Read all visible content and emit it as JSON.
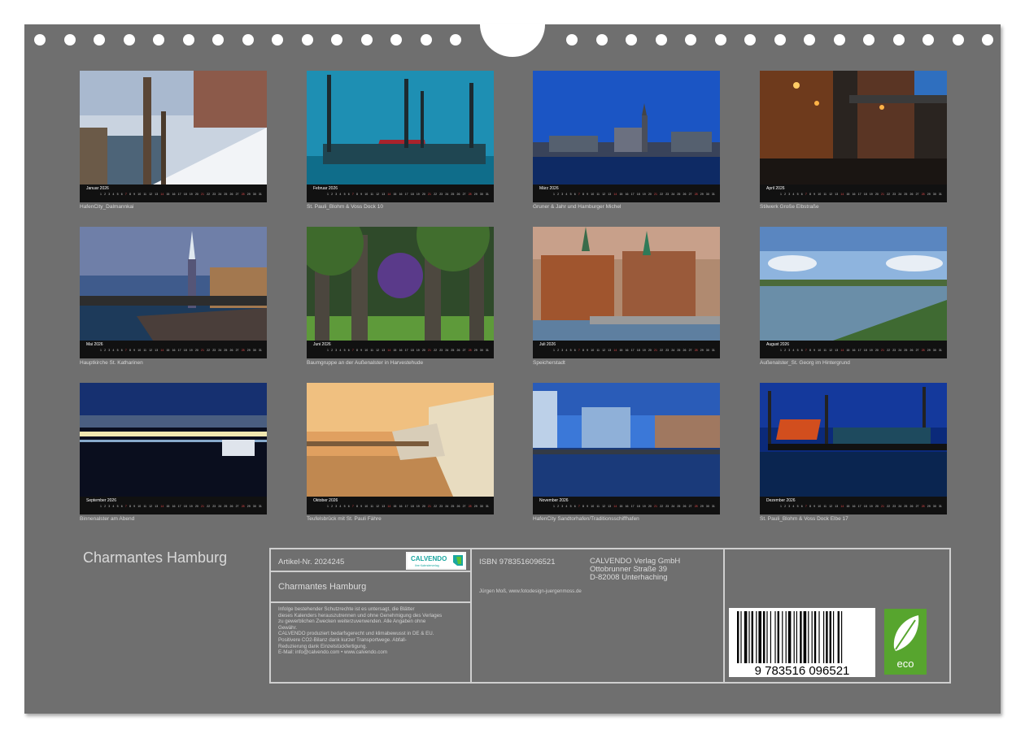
{
  "months": [
    {
      "name": "Januar",
      "year": "2026",
      "caption": "HafenCity_Dalmannkai"
    },
    {
      "name": "Februar",
      "year": "2026",
      "caption": "St. Pauli_Blohm & Voss Dock 10"
    },
    {
      "name": "März",
      "year": "2026",
      "caption": "Gruner & Jahr und Hamburger Michel"
    },
    {
      "name": "April",
      "year": "2026",
      "caption": "Stilwerk Große Elbstraße"
    },
    {
      "name": "Mai",
      "year": "2026",
      "caption": "Hauptkirche St. Katharinen"
    },
    {
      "name": "Juni",
      "year": "2026",
      "caption": "Baumgruppe an der Außenalster in Harvestehude"
    },
    {
      "name": "Juli",
      "year": "2026",
      "caption": "Speicherstadt"
    },
    {
      "name": "August",
      "year": "2026",
      "caption": "Außenalster_St. Georg im Hintergrund"
    },
    {
      "name": "September",
      "year": "2026",
      "caption": "Binnenalster am Abend"
    },
    {
      "name": "Oktober",
      "year": "2026",
      "caption": "Teufelsbrück mit St. Pauli Fähre"
    },
    {
      "name": "November",
      "year": "2026",
      "caption": "HafenCity Sandtorhafen/Traditionsschiffhafen"
    },
    {
      "name": "Dezember",
      "year": "2026",
      "caption": "St. Pauli_Blohm & Voss Dock Elbe 17"
    }
  ],
  "footer": {
    "title": "Charmantes Hamburg",
    "article": "Artikel-Nr. 2024245",
    "box_title": "Charmantes Hamburg",
    "legal": [
      "Infolge bestehender Schutzrechte ist es untersagt, die Blätter",
      "dieses Kalenders herauszutrennen und ohne Genehmigung des Verlages",
      "zu gewerblichen Zwecken weiterzuverwenden. Alle Angaben ohne",
      "Gewähr.",
      "CALVENDO produziert bedarfsgerecht und klimabewusst in DE & EU.",
      "Positivere CO2-Bilanz dank kurzer Transportwege. Abfall-",
      "Reduzierung dank Einzelstückfertigung.",
      "E-Mail: info@calvendo.com • www.calvendo.com"
    ],
    "isbn": "ISBN 9783516096521",
    "publisher": [
      "CALVENDO Verlag GmbH",
      "Ottobrunner Straße 39",
      "D-82008 Unterhaching"
    ],
    "author": "Jürgen Moß, www.fotodesign-juergenmoss.de",
    "calvendo_logo": "CALVENDO",
    "calvendo_sub": "Ihre Kalenderverlag",
    "barcode_text": "9 783516 096521",
    "eco_label": "eco"
  },
  "colors": {
    "sheet": "#6f6f6f",
    "eco_green": "#57a52e",
    "logo_teal": "#1aa6a0"
  }
}
